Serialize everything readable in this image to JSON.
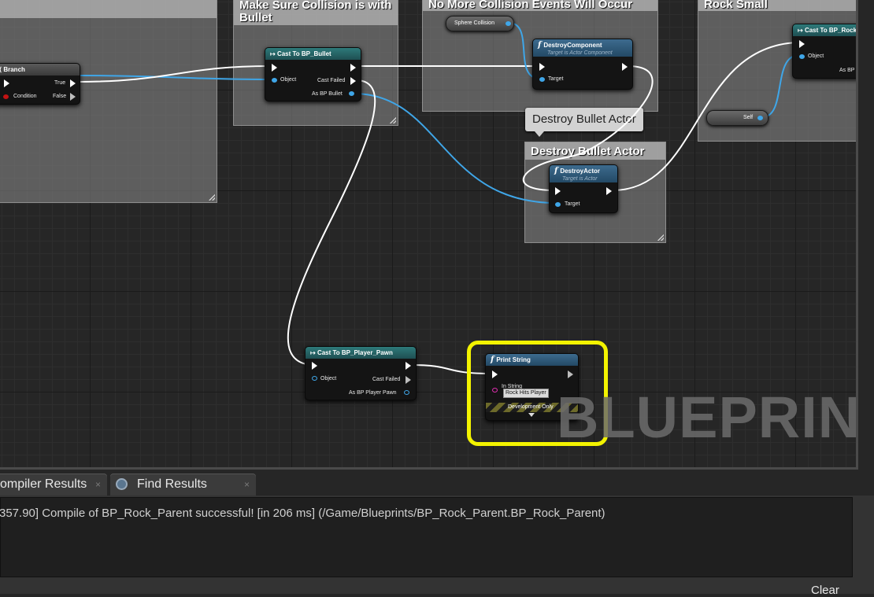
{
  "comments": {
    "top_left": "",
    "collision": "Make Sure Collision is with\nBullet",
    "no_more": "No More Collision Events Will Occur",
    "rock_small": "Rock Small",
    "destroy_bullet": "Destroy Bullet Actor"
  },
  "bubble": "Destroy Bullet Actor",
  "nodes": {
    "branch": {
      "title": "Branch",
      "true": "True",
      "condition": "Condition",
      "false": "False"
    },
    "cast_bullet": {
      "title": "Cast To BP_Bullet",
      "object": "Object",
      "cast_failed": "Cast Failed",
      "as": "As BP Bullet"
    },
    "destroy_component": {
      "title": "DestroyComponent",
      "subtitle": "Target is Actor Component",
      "target": "Target"
    },
    "sphere_collision": "Sphere Collision",
    "cast_rock": {
      "title": "Cast To BP_Rock_",
      "object": "Object",
      "as": "As BP"
    },
    "self": "Self",
    "destroy_actor": {
      "title": "DestroyActor",
      "subtitle": "Target is Actor",
      "target": "Target"
    },
    "cast_pawn": {
      "title": "Cast To BP_Player_Pawn",
      "object": "Object",
      "cast_failed": "Cast Failed",
      "as": "As BP Player Pawn"
    },
    "print_string": {
      "title": "Print String",
      "in_string": "In String",
      "value": "Rock Hits Player",
      "dev": "Development Only"
    }
  },
  "watermark": "BLUEPRINT",
  "tabs": [
    {
      "label": "ompiler Results"
    },
    {
      "label": "Find Results"
    }
  ],
  "log_line": "357.90] Compile of BP_Rock_Parent successful! [in 206 ms] (/Game/Blueprints/BP_Rock_Parent.BP_Rock_Parent)",
  "clear_label": "Clear",
  "colors": {
    "exec_wire": "#ffffff",
    "object_wire": "#3fa6e8",
    "highlight": "#f3f300",
    "cast_header": "#2e7a7a",
    "func_header": "#3d6b8e"
  }
}
